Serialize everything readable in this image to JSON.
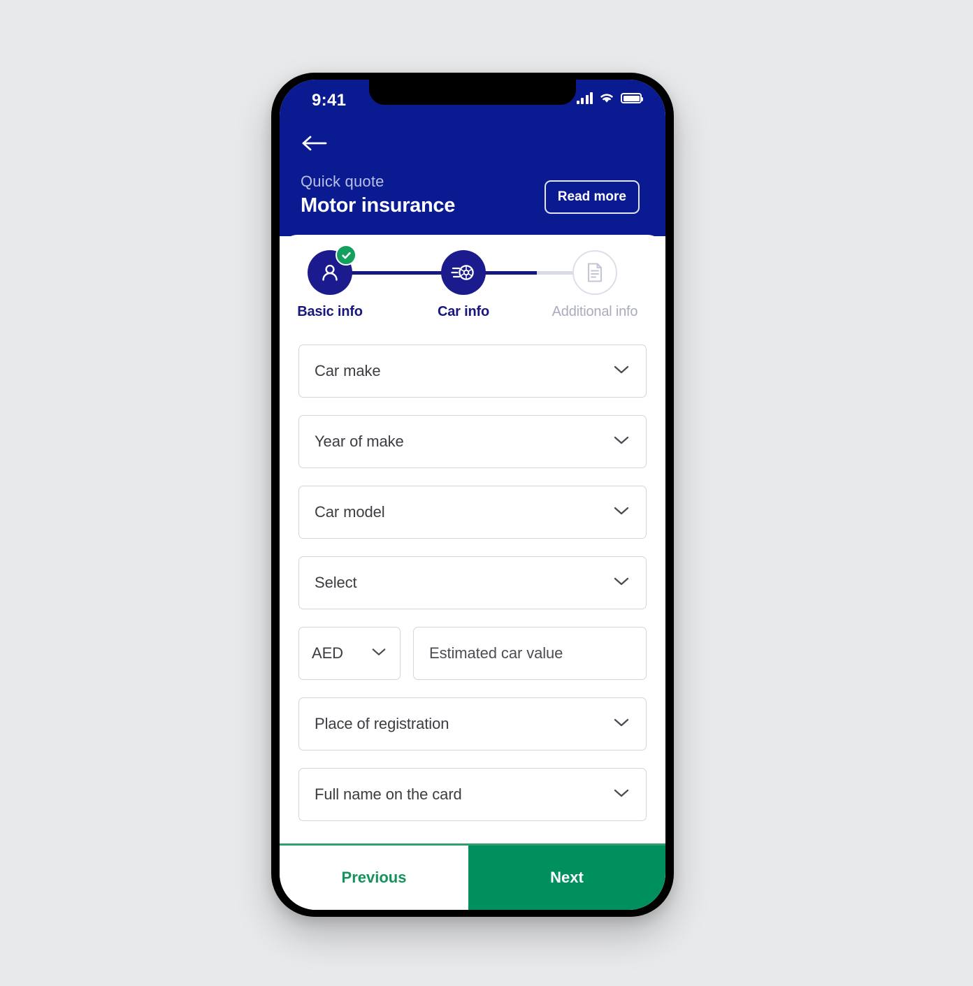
{
  "status_bar": {
    "time": "9:41",
    "icons": [
      "signal-icon",
      "wifi-icon",
      "battery-icon"
    ]
  },
  "header": {
    "back_icon": "back-arrow-icon",
    "eyebrow": "Quick quote",
    "title": "Motor insurance",
    "read_more_label": "Read more",
    "background_color": "#0a1a91"
  },
  "stepper": {
    "steps": [
      {
        "label": "Basic info",
        "icon": "person-icon",
        "state": "completed",
        "badge": "check-icon"
      },
      {
        "label": "Car info",
        "icon": "car-wheel-icon",
        "state": "active",
        "badge": ""
      },
      {
        "label": "Additional info",
        "icon": "document-icon",
        "state": "inactive",
        "badge": ""
      }
    ],
    "active_color": "#18177f",
    "completed_badge_color": "#13a05f",
    "inactive_color": "#a9adbb"
  },
  "form": {
    "fields": [
      {
        "name": "car-make",
        "placeholder": "Car make",
        "type": "select",
        "icon": "chevron-down-icon"
      },
      {
        "name": "year-of-make",
        "placeholder": "Year of make",
        "type": "select",
        "icon": "chevron-down-icon"
      },
      {
        "name": "car-model",
        "placeholder": "Car model",
        "type": "select",
        "icon": "chevron-down-icon"
      },
      {
        "name": "select",
        "placeholder": "Select",
        "type": "select",
        "icon": "chevron-down-icon"
      }
    ],
    "currency": {
      "name": "currency",
      "value": "AED",
      "type": "select",
      "icon": "chevron-down-icon"
    },
    "car_value": {
      "name": "estimated-car-value",
      "placeholder": "Estimated car value",
      "type": "text",
      "value": ""
    },
    "fields_after": [
      {
        "name": "place-of-registration",
        "placeholder": "Place of registration",
        "type": "select",
        "icon": "chevron-down-icon"
      },
      {
        "name": "full-name-on-card",
        "placeholder": "Full name on the card",
        "type": "select",
        "icon": "chevron-down-icon"
      }
    ]
  },
  "footer": {
    "previous_label": "Previous",
    "next_label": "Next",
    "previous_color": "#16935c",
    "next_background": "#00905e"
  }
}
